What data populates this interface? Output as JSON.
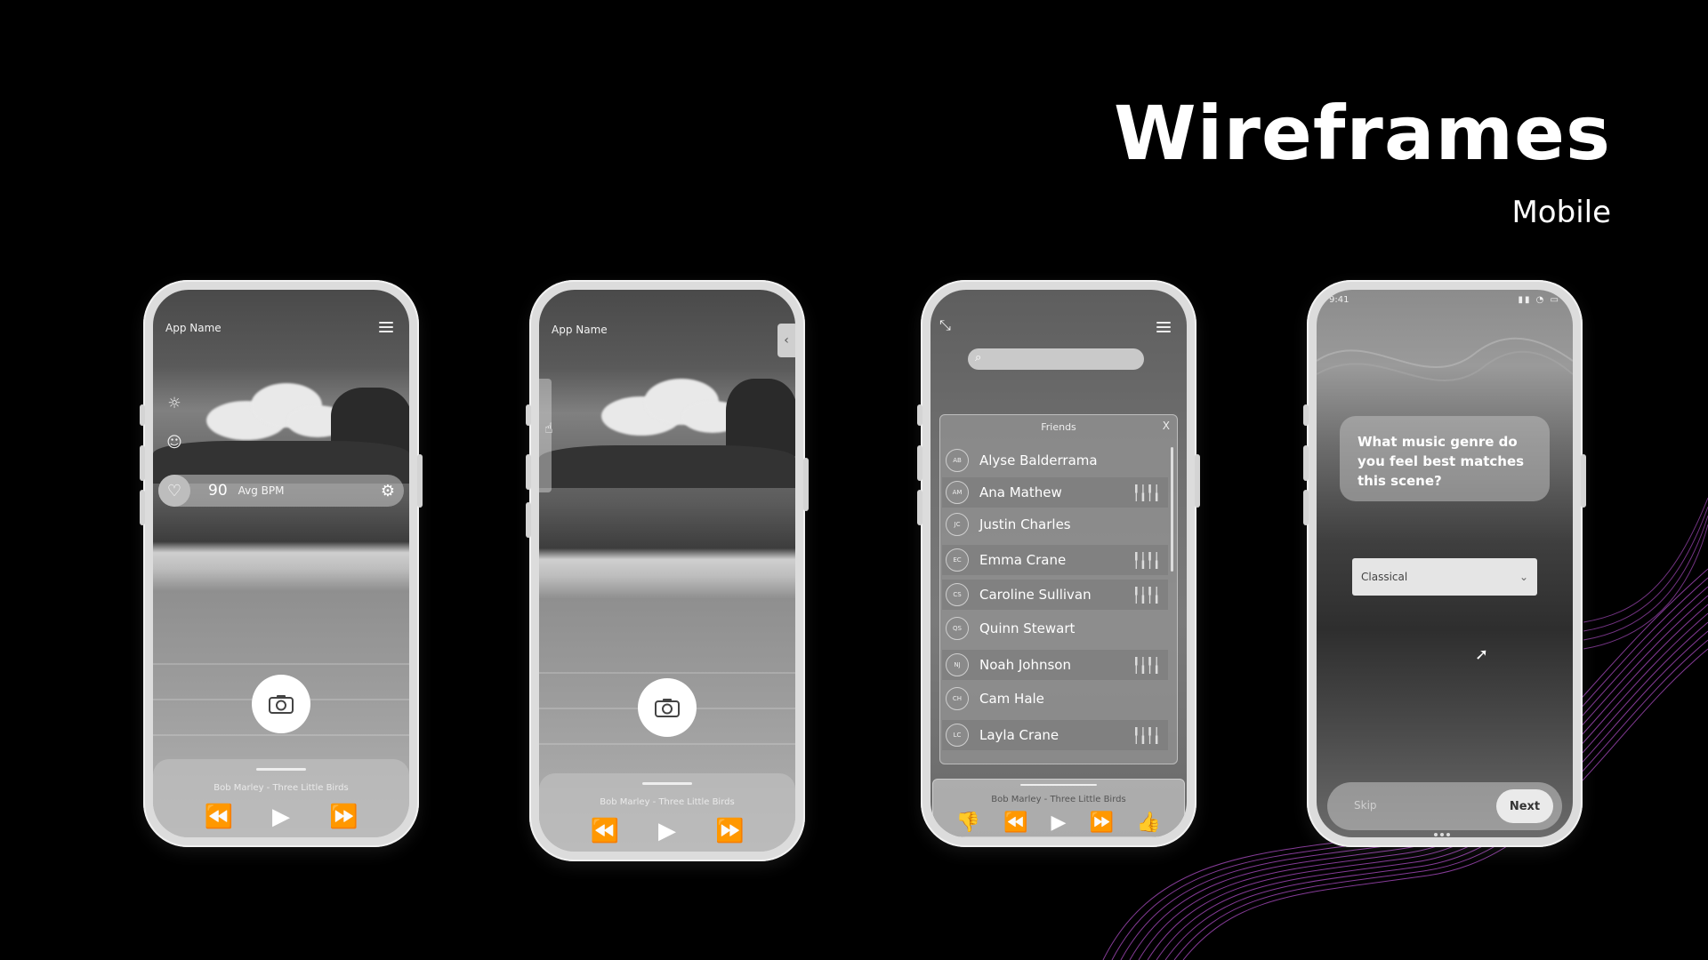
{
  "page": {
    "title": "Wireframes",
    "subtitle": "Mobile"
  },
  "phone1": {
    "app_name": "App Name",
    "bpm_value": "90",
    "bpm_label": "Avg BPM",
    "song": "Bob Marley - Three Little Birds"
  },
  "phone2": {
    "app_name": "App Name",
    "song": "Bob Marley - Three Little Birds"
  },
  "phone3": {
    "panel_title": "Friends",
    "close_label": "X",
    "song": "Bob Marley - Three Little Birds",
    "friends": [
      {
        "initials": "AB",
        "name": "Alyse Balderrama",
        "active": false
      },
      {
        "initials": "AM",
        "name": "Ana Mathew",
        "active": true
      },
      {
        "initials": "JC",
        "name": "Justin Charles",
        "active": false
      },
      {
        "initials": "EC",
        "name": "Emma Crane",
        "active": true
      },
      {
        "initials": "CS",
        "name": "Caroline Sullivan",
        "active": true
      },
      {
        "initials": "QS",
        "name": "Quinn Stewart",
        "active": false
      },
      {
        "initials": "NJ",
        "name": "Noah Johnson",
        "active": true
      },
      {
        "initials": "CH",
        "name": "Cam Hale",
        "active": false
      },
      {
        "initials": "LC",
        "name": "Layla Crane",
        "active": true
      }
    ]
  },
  "phone4": {
    "time": "9:41",
    "question": "What music genre do you feel best matches this scene?",
    "selected_genre": "Classical",
    "skip_label": "Skip",
    "next_label": "Next"
  },
  "colors": {
    "background": "#000000",
    "accent_wave": "#b04fc8",
    "phone_frame": "#dcdcdc"
  }
}
